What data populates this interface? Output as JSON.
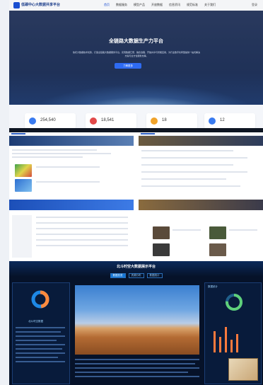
{
  "site": {
    "brand": "低碳中心大数据共享平台",
    "nav": [
      "首页",
      "数据服务",
      "模型产品",
      "开放数据",
      "信息资讯",
      "规范标准",
      "关于我们"
    ],
    "nav_active_index": 0,
    "login": "登录"
  },
  "hero": {
    "title": "全链路大数据生产力平台",
    "description": "依托大数据技术优势，打造全链路大数据服务平台，实现数据汇聚、融合治理、开放共享与智能应用，为行业数字化转型提供一站式解决方案与全方位服务支撑。",
    "button": "了解更多"
  },
  "stats": [
    {
      "value": "254,540",
      "unit": "+",
      "color": "#3a7bf0"
    },
    {
      "value": "18,541",
      "unit": "",
      "color": "#e24a4a"
    },
    {
      "value": "18",
      "unit": "",
      "color": "#f0a32b"
    },
    {
      "value": "12",
      "unit": "",
      "color": "#3a7bf0"
    }
  ],
  "dashboard": {
    "title": "北斗时空大数据展示平台",
    "tabs": [
      "数据总览",
      "资源分布",
      "数据统计"
    ],
    "active_tab_index": 0,
    "left_panel_title": "北斗时空数据",
    "right_panel_title": "数据统计"
  }
}
